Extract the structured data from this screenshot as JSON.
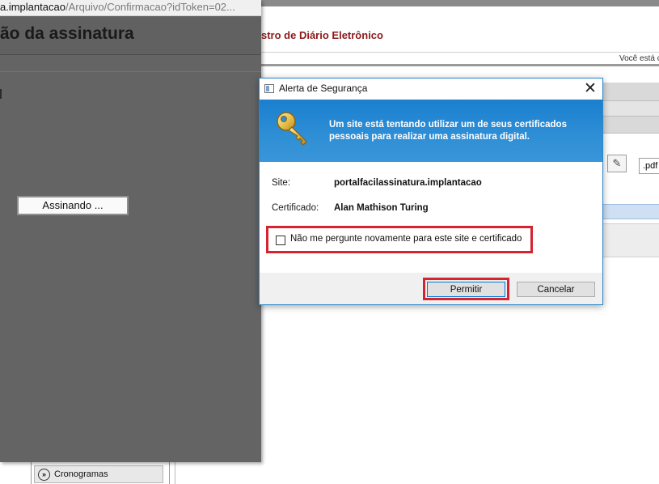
{
  "background_page": {
    "title_fragment": "stro de Diário Eletrônico",
    "user_fragment": "Você está c",
    "pdf_field_value": ".pdf",
    "menu_item": "Cronogramas"
  },
  "popup": {
    "url_host": "a.implantacao",
    "url_path": "/Arquivo/Confirmacao?idToken=02...",
    "heading": "ão da assinatura",
    "signing_button": "Assinando ..."
  },
  "dialog": {
    "title": "Alerta de Segurança",
    "close_glyph": "✕",
    "banner_message": "Um site está tentando utilizar um de seus certificados pessoais para realizar uma assinatura digital.",
    "site_label": "Site:",
    "site_value": "portalfacilassinatura.implantacao",
    "certificate_label": "Certificado:",
    "certificate_value": "Alan Mathison Turing",
    "dont_ask_label": "Não me pergunte novamente para este site e certificado",
    "dont_ask_checked": false,
    "permit_button": "Permitir",
    "cancel_button": "Cancelar",
    "accent_color": "#1a7fcf",
    "highlight_color": "#d5232f"
  },
  "icons": {
    "dialog_app": "window-app-icon",
    "banner": "key-icon",
    "edit": "pencil-edit-icon",
    "menu_chevron": "double-chevron-right-icon"
  }
}
